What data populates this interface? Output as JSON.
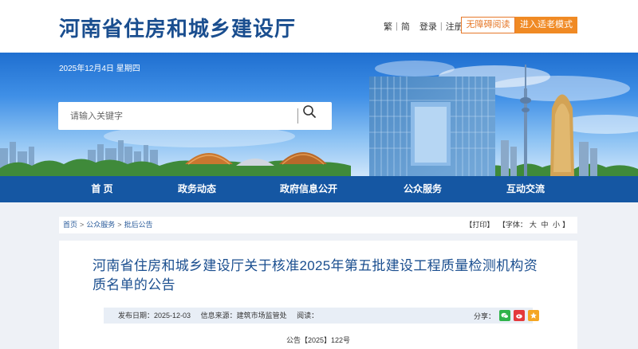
{
  "header": {
    "site_title": "河南省住房和城乡建设厅",
    "traditional": "繁",
    "simplified": "简",
    "login": "登录",
    "register": "注册",
    "accessibility_button": "无障碍阅读",
    "elder_mode_button": "进入适老模式"
  },
  "banner": {
    "date": "2025年12月4日 星期四",
    "search_placeholder": "请输入关键字",
    "search_value": ""
  },
  "nav": {
    "items": [
      {
        "label": "首  页"
      },
      {
        "label": "政务动态"
      },
      {
        "label": "政府信息公开"
      },
      {
        "label": "公众服务"
      },
      {
        "label": "互动交流"
      }
    ]
  },
  "breadcrumb": {
    "items": [
      "首页",
      "公众服务",
      "批后公告"
    ],
    "separator": ">"
  },
  "tools": {
    "print": "【打印】",
    "font_label": "【字体：",
    "font_large": "大",
    "font_medium": "中",
    "font_small": "小",
    "font_close": "】"
  },
  "article": {
    "title": "河南省住房和城乡建设厅关于核准2025年第五批建设工程质量检测机构资质名单的公告",
    "publish_date": "发布日期：2025-12-03",
    "source": "信息来源：建筑市场监管处",
    "views": "阅读：",
    "share_label": "分享：",
    "doc_number": "公告【2025】122号"
  },
  "colors": {
    "brand_blue": "#1a4e8f",
    "nav_blue": "#1557a3",
    "accent_orange": "#f08a24"
  },
  "icons": {
    "search": "search-icon",
    "share": [
      "wechat-icon",
      "weibo-icon",
      "qzone-icon"
    ]
  }
}
